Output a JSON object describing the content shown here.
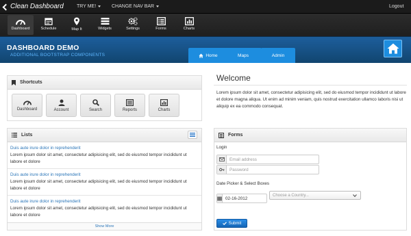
{
  "navbar": {
    "brand": "Clean Dashboard",
    "try_me": "TRY ME!",
    "change_nav": "CHANGE NAV BAR",
    "logout": "Logout"
  },
  "toolbar": {
    "items": [
      {
        "label": "Dashboard",
        "icon": "dashboard-icon"
      },
      {
        "label": "Schedule",
        "icon": "calendar-icon"
      },
      {
        "label": "Map It",
        "icon": "map-marker-icon"
      },
      {
        "label": "Widgets",
        "icon": "list-icon"
      },
      {
        "label": "Settings",
        "icon": "cogs-icon"
      },
      {
        "label": "Forms",
        "icon": "form-icon"
      },
      {
        "label": "Charts",
        "icon": "bar-chart-icon"
      }
    ]
  },
  "header": {
    "title": "DASHBOARD DEMO",
    "subtitle": "ADDITIONAL BOOTSTRAP COMPONENTS",
    "tabs": [
      {
        "label": "Home",
        "icon": "home-icon"
      },
      {
        "label": "Maps"
      },
      {
        "label": "Admin"
      }
    ]
  },
  "shortcuts": {
    "title": "Shortcuts",
    "items": [
      {
        "label": "Dashboard",
        "icon": "dashboard-icon"
      },
      {
        "label": "Account",
        "icon": "user-icon"
      },
      {
        "label": "Search",
        "icon": "search-icon"
      },
      {
        "label": "Reports",
        "icon": "reports-icon"
      },
      {
        "label": "Charts",
        "icon": "bar-chart-icon"
      }
    ]
  },
  "lists": {
    "title": "Lists",
    "items": [
      {
        "link": "Duis aute irure dolor in reprehenderit",
        "text": "Lorem ipsum dolor sit amet, consectetur adipisicing elit, sed do eiusmod tempor incididunt ut labore et dolore"
      },
      {
        "link": "Duis aute irure dolor in reprehenderit",
        "text": "Lorem ipsum dolor sit amet, consectetur adipisicing elit, sed do eiusmod tempor incididunt ut labore et dolore"
      },
      {
        "link": "Duis aute irure dolor in reprehenderit",
        "text": "Lorem ipsum dolor sit amet, consectetur adipisicing elit, sed do eiusmod tempor incididunt ut labore et dolore"
      }
    ],
    "show_more": "Show More"
  },
  "welcome": {
    "title": "Welcome",
    "text": "Lorem ipsum dolor sit amet, consectetur adipisicing elit, sed do eiusmod tempor incididunt ut labore et dolore magna aliqua. Ut enim ad minim veniam, quis nostrud exercitation ullamco laboris nisi ut aliquip ex ea commodo consequat."
  },
  "forms": {
    "title": "Forms",
    "login_label": "Login",
    "email_placeholder": "Email address",
    "password_placeholder": "Password",
    "datepicker_label": "Date Picker & Select Boxes",
    "date_value": "02-16-2012",
    "country_placeholder": "Choose a Country...",
    "submit_label": "Submit"
  },
  "colors": {
    "accent": "#1d8ddf",
    "header_bg": "#1a5a96",
    "link": "#2a75b8"
  }
}
